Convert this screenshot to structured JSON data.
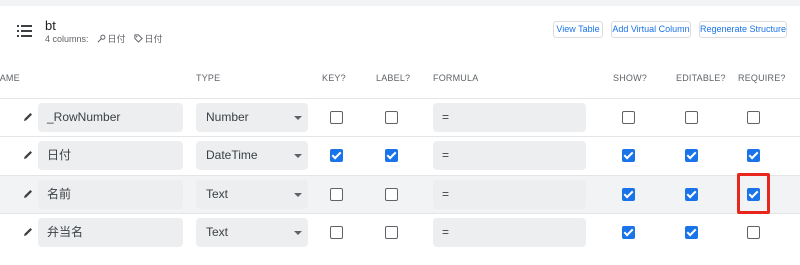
{
  "table": {
    "name": "bt",
    "column_count": "4 columns:",
    "key_chip": "日付",
    "label_chip": "日付"
  },
  "actions": {
    "view_table": "View Table",
    "add_virtual_column": "Add Virtual Column",
    "regenerate_structure": "Regenerate Structure"
  },
  "columns_header": {
    "name": "NAME",
    "type": "TYPE",
    "key": "KEY?",
    "label": "LABEL?",
    "formula": "FORMULA",
    "show": "SHOW?",
    "editable": "EDITABLE?",
    "require": "REQUIRE?"
  },
  "rows": [
    {
      "name": "_RowNumber",
      "type": "Number",
      "formula": "=",
      "key": false,
      "label": false,
      "show": false,
      "editable": false,
      "require": false
    },
    {
      "name": "日付",
      "type": "DateTime",
      "formula": "=",
      "key": true,
      "label": true,
      "show": true,
      "editable": true,
      "require": true
    },
    {
      "name": "名前",
      "type": "Text",
      "formula": "=",
      "key": false,
      "label": false,
      "show": true,
      "editable": true,
      "require": true
    },
    {
      "name": "弁当名",
      "type": "Text",
      "formula": "=",
      "key": false,
      "label": false,
      "show": true,
      "editable": true,
      "require": false
    }
  ],
  "colors": {
    "accent": "#1a73e8",
    "highlight": "#e8261c"
  }
}
